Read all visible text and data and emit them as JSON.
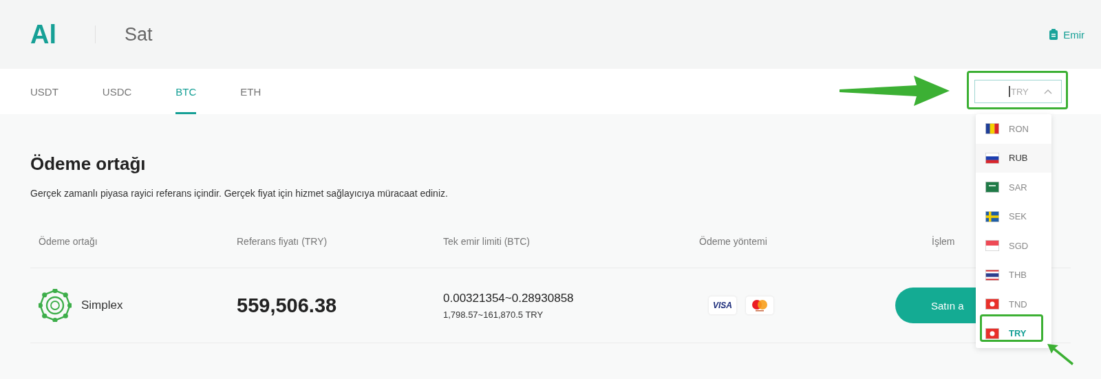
{
  "header": {
    "logo": "Al",
    "title": "Sat",
    "orders_link": "Emir"
  },
  "tabs": [
    {
      "label": "USDT",
      "selected": false
    },
    {
      "label": "USDC",
      "selected": false
    },
    {
      "label": "BTC",
      "selected": true
    },
    {
      "label": "ETH",
      "selected": false
    }
  ],
  "currency_select": {
    "placeholder": "TRY",
    "expanded": true,
    "options": [
      {
        "label": "RON",
        "selected": false,
        "hovered": false
      },
      {
        "label": "RUB",
        "selected": false,
        "hovered": true
      },
      {
        "label": "SAR",
        "selected": false,
        "hovered": false
      },
      {
        "label": "SEK",
        "selected": false,
        "hovered": false
      },
      {
        "label": "SGD",
        "selected": false,
        "hovered": false
      },
      {
        "label": "THB",
        "selected": false,
        "hovered": false
      },
      {
        "label": "TND",
        "selected": false,
        "hovered": false
      },
      {
        "label": "TRY",
        "selected": true,
        "hovered": false
      }
    ]
  },
  "section": {
    "title": "Ödeme ortağı",
    "subtitle": "Gerçek zamanlı piyasa rayici referans içindir. Gerçek fiyat için hizmet sağlayıcıya müracaat ediniz."
  },
  "table": {
    "columns": [
      "Ödeme ortağı",
      "Referans fiyatı (TRY)",
      "Tek emir limiti (BTC)",
      "Ödeme yöntemi",
      "İşlem"
    ],
    "rows": [
      {
        "partner": "Simplex",
        "price": "559,506.38",
        "limit_btc": "0.00321354~0.28930858",
        "limit_try": "1,798.57~161,870.5 TRY",
        "payment_methods": [
          {
            "kind": "visa",
            "label": "VISA"
          },
          {
            "kind": "mastercard"
          }
        ],
        "action": "Satın a"
      }
    ]
  }
}
